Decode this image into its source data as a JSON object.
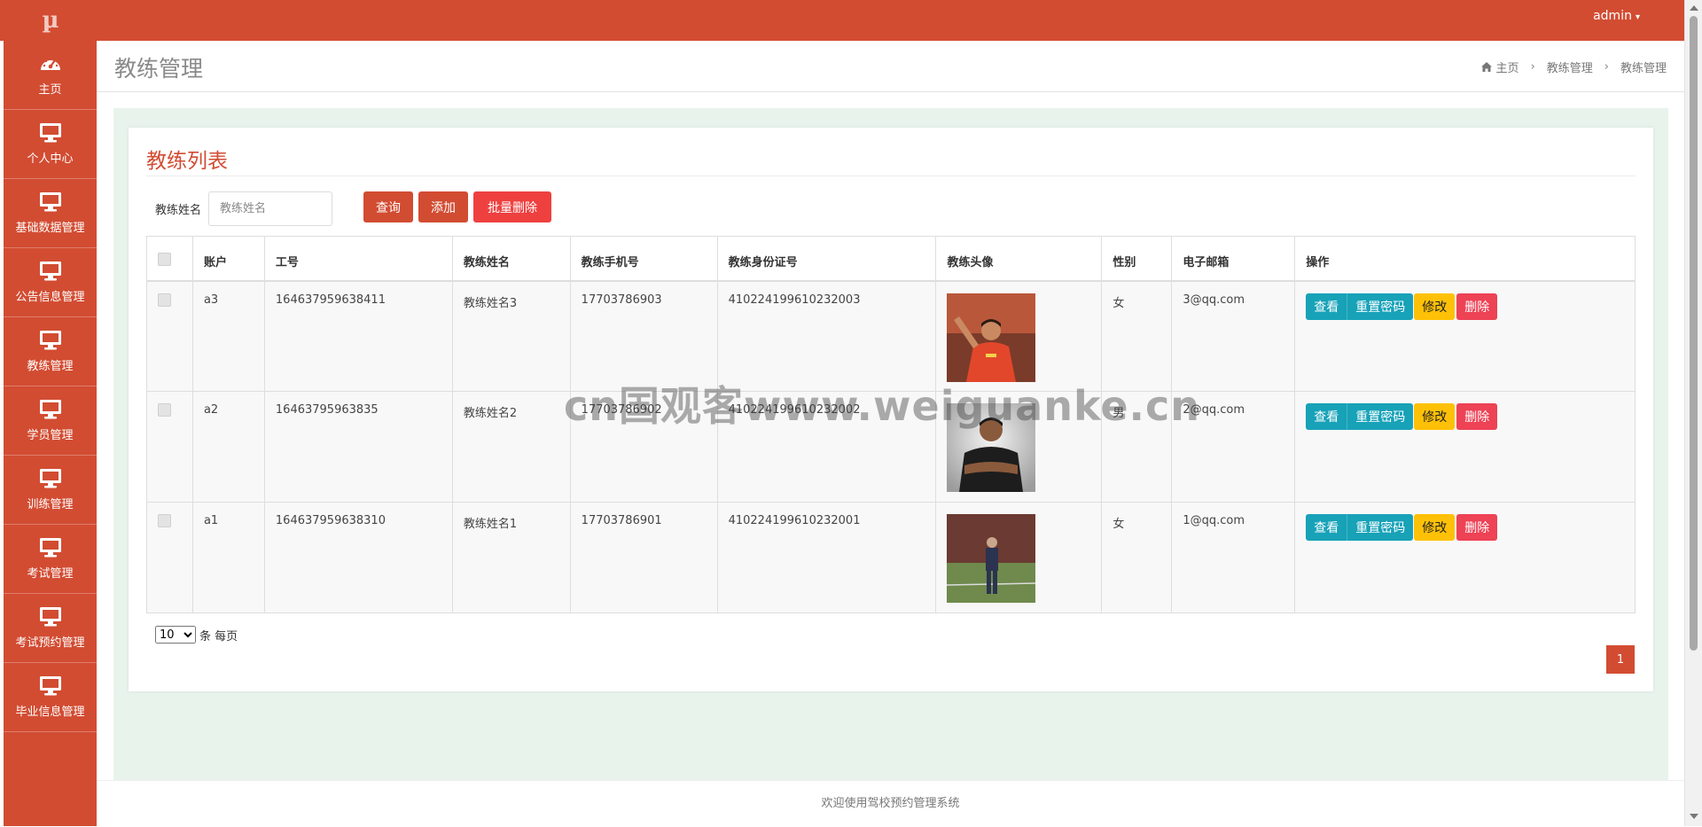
{
  "app": {
    "logo_text": "µ"
  },
  "user": {
    "name": "admin"
  },
  "sidebar": {
    "items": [
      {
        "label": "主页",
        "icon": "dashboard-icon"
      },
      {
        "label": "个人中心",
        "icon": "monitor-icon"
      },
      {
        "label": "基础数据管理",
        "icon": "monitor-icon"
      },
      {
        "label": "公告信息管理",
        "icon": "monitor-icon"
      },
      {
        "label": "教练管理",
        "icon": "monitor-icon"
      },
      {
        "label": "学员管理",
        "icon": "monitor-icon"
      },
      {
        "label": "训练管理",
        "icon": "monitor-icon"
      },
      {
        "label": "考试管理",
        "icon": "monitor-icon"
      },
      {
        "label": "考试预约管理",
        "icon": "monitor-icon"
      },
      {
        "label": "毕业信息管理",
        "icon": "monitor-icon"
      }
    ]
  },
  "header": {
    "title": "教练管理",
    "breadcrumb": [
      "主页",
      "教练管理",
      "教练管理"
    ]
  },
  "card": {
    "title": "教练列表"
  },
  "search": {
    "label": "教练姓名",
    "placeholder": "教练姓名",
    "query_label": "查询",
    "add_label": "添加",
    "batch_delete_label": "批量删除"
  },
  "table": {
    "columns": [
      "账户",
      "工号",
      "教练姓名",
      "教练手机号",
      "教练身份证号",
      "教练头像",
      "性别",
      "电子邮箱",
      "操作"
    ],
    "rows": [
      {
        "account": "a3",
        "job_no": "164637959638411",
        "name": "教练姓名3",
        "phone": "17703786903",
        "id_card": "410224199610232003",
        "gender": "女",
        "email": "3@qq.com"
      },
      {
        "account": "a2",
        "job_no": "16463795963835",
        "name": "教练姓名2",
        "phone": "17703786902",
        "id_card": "410224199610232002",
        "gender": "男",
        "email": "2@qq.com"
      },
      {
        "account": "a1",
        "job_no": "164637959638310",
        "name": "教练姓名1",
        "phone": "17703786901",
        "id_card": "410224199610232001",
        "gender": "女",
        "email": "1@qq.com"
      }
    ],
    "actions": {
      "view": "查看",
      "reset": "重置密码",
      "edit": "修改",
      "delete": "删除"
    }
  },
  "pagination": {
    "page_size": "10",
    "page_size_suffix": "条 每页",
    "current_page": "1"
  },
  "watermark": "cn国观客www.weiguanke.cn",
  "footer": {
    "text": "欢迎使用驾校预约管理系统"
  },
  "colors": {
    "primary": "#d24c32",
    "info": "#17a2b8",
    "warning": "#ffc107",
    "danger": "#ee4255",
    "content_bg": "#e8f3ec"
  }
}
